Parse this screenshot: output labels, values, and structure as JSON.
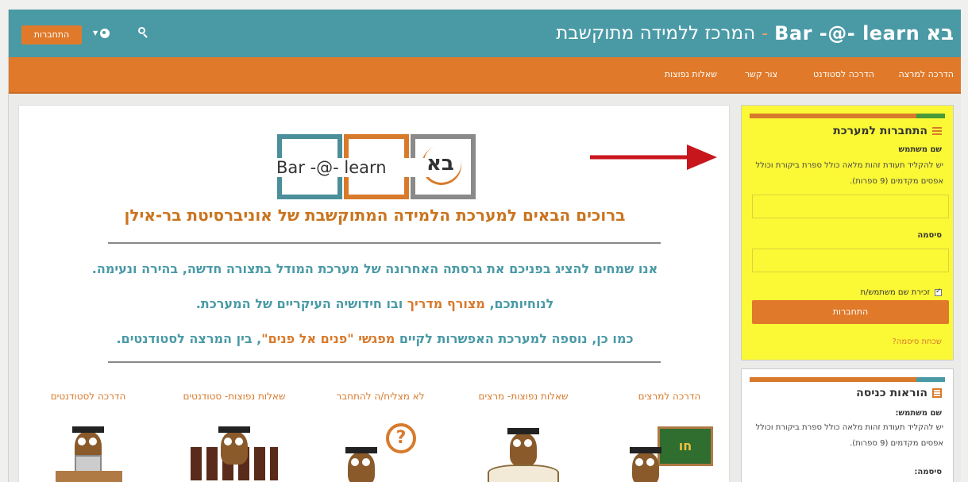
{
  "header": {
    "login_button": "התחברות",
    "site_title": "המרכז ללמידה מתוקשבת",
    "brand_name": "Bar -@- learn",
    "brand_mark": "בא"
  },
  "nav": {
    "items": [
      "הדרכה למרצה",
      "הדרכה לסטודנט",
      "צור קשר",
      "שאלות נפוצות"
    ]
  },
  "main": {
    "logo_text": "Bar -@- learn",
    "logo_mark": "בא",
    "heading": "ברוכים הבאים למערכת הלמידה המתוקשבת של אוניברסיטת בר-אילן",
    "p1": "אנו שמחים להציג בפניכם את גרסתה האחרונה של מערכת המודל בתצורה חדשה, בהירה ונעימה.",
    "p2_a": "לנוחיותכם, ",
    "p2_b": "מצורף מדריך",
    "p2_c": " ובו חידושיה העיקריים של המערכת.",
    "p3_a": "כמו כן, נוספה למערכת האפשרות לקיים ",
    "p3_b": "מפגשי \"פנים אל פנים\"",
    "p3_c": ", בין המרצה לסטודנטים.",
    "tiles": [
      {
        "label": "הדרכה למרצים"
      },
      {
        "label": "שאלות נפוצות- מרצים"
      },
      {
        "label": "לא מצליח/ה להתחבר"
      },
      {
        "label": "שאלות נפוצות- סטודנטים"
      },
      {
        "label": "הדרכה לסטודנטים"
      }
    ],
    "board_text": "חו"
  },
  "login": {
    "title": "התחברות למערכת",
    "username_label": "שם משתמש",
    "username_help": "יש להקליד תעודת זהות מלאה כולל ספרת ביקורת וכולל אפסים מקדמים (9 ספרות).",
    "password_label": "סיסמה",
    "remember": "זכירת שם משתמש/ת",
    "submit": "התחברות",
    "forgot": "שכחת סיסמה?"
  },
  "instructions": {
    "title": "הוראות כניסה",
    "username_label": "שם משתמש:",
    "username_help": "יש להקליד תעודת זהות מלאה כולל ספרת ביקורת וכולל אפסים מקדמים (9 ספרות).",
    "password_label": "סיסמה:"
  },
  "colors": {
    "teal": "#4a9aa6",
    "orange": "#e07a2a",
    "yellow": "#fbf836",
    "arrow_red": "#c8161d"
  }
}
